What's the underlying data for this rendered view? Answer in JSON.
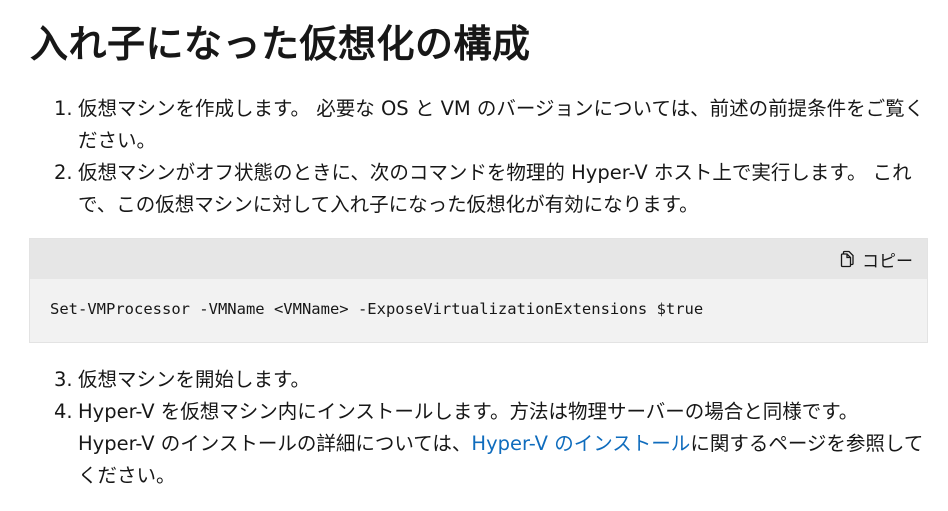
{
  "heading": "入れ子になった仮想化の構成",
  "steps_before_code": [
    {
      "number": "1.",
      "text": "仮想マシンを作成します。 必要な OS と VM のバージョンについては、前述の前提条件をご覧ください。"
    },
    {
      "number": "2.",
      "text": "仮想マシンがオフ状態のときに、次のコマンドを物理的 Hyper-V ホスト上で実行します。 これで、この仮想マシンに対して入れ子になった仮想化が有効になります。"
    }
  ],
  "code_block": {
    "copy_icon": "copy-icon",
    "copy_label": "コピー",
    "code": "Set-VMProcessor -VMName <VMName> -ExposeVirtualizationExtensions $true"
  },
  "steps_after_code": [
    {
      "number": "3.",
      "text": "仮想マシンを開始します。"
    },
    {
      "number": "4.",
      "text_line1": "Hyper-V を仮想マシン内にインストールします。方法は物理サーバーの場合と同様です。",
      "text_before_link": "Hyper-V のインストールの詳細については、",
      "link_text": "Hyper-V のインストール",
      "text_after_link": "に関するページを参照してください。"
    }
  ],
  "colors": {
    "text": "#171717",
    "link": "#0f6cbd",
    "code_background": "#f2f2f2",
    "code_header_background": "#e6e6e6"
  }
}
